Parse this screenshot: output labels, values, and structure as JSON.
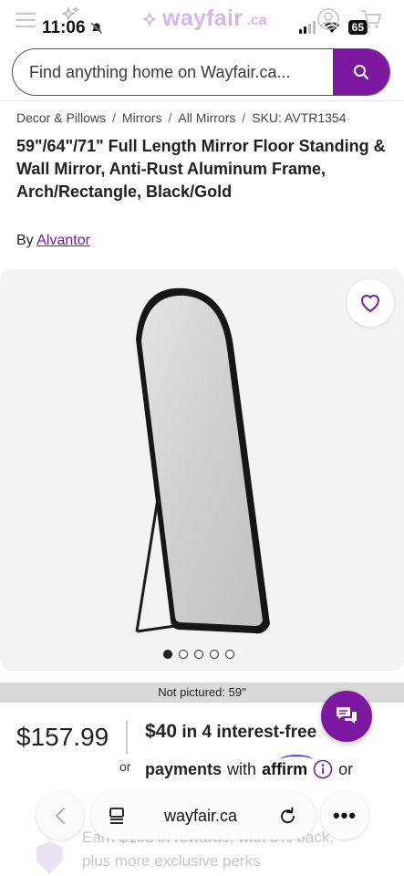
{
  "status_bar": {
    "time": "11:06",
    "battery": "65"
  },
  "header": {
    "logo_text": "wayfair",
    "logo_tld": ".ca"
  },
  "search": {
    "placeholder": "Find anything home on Wayfair.ca..."
  },
  "breadcrumb": {
    "items": [
      "Decor & Pillows",
      "Mirrors",
      "All Mirrors",
      "SKU: AVTR1354"
    ],
    "separator": "/"
  },
  "product": {
    "title": "59\"/64\"/71\" Full Length Mirror Floor Standing & Wall Mirror, Anti-Rust Aluminum Frame, Arch/Rectangle, Black/Gold",
    "by_label": "By",
    "brand": "Alvantor",
    "not_pictured": "Not pictured: 59\"",
    "carousel": {
      "count": 5,
      "active_index": 0
    }
  },
  "pricing": {
    "price": "$157.99",
    "or_label": "or",
    "installment_amount": "$40",
    "installment_text": "in 4 interest-free",
    "payments_label": "payments",
    "with_label": "with",
    "affirm": "affirm",
    "trailing_or": "or"
  },
  "rewards": {
    "line1": "Earn $158 in rewards, with 5% back,",
    "line2": "plus more exclusive perks"
  },
  "safari": {
    "url": "wayfair.ca",
    "more_label": "•••"
  },
  "colors": {
    "brand_purple": "#7b189f",
    "logo_faded": "#d6b6ea",
    "gallery_bg": "#f3f3f3"
  },
  "icons": [
    "menu-icon",
    "sparkle-icon",
    "bell-slash-icon",
    "account-icon",
    "cart-icon",
    "search-icon",
    "heart-icon",
    "chat-icon",
    "info-icon",
    "chevron-left-icon",
    "reader-icon",
    "reload-icon",
    "more-icon"
  ]
}
